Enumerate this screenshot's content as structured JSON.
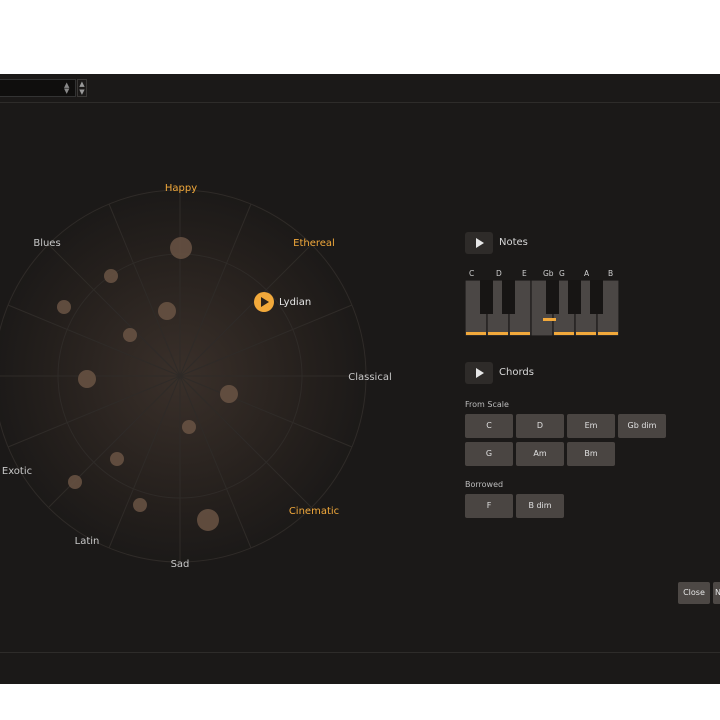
{
  "field": {
    "value": ""
  },
  "wheel": {
    "moods": [
      {
        "label": "Happy",
        "highlight": true
      },
      {
        "label": "Ethereal",
        "highlight": true
      },
      {
        "label": "Classical",
        "highlight": false
      },
      {
        "label": "Cinematic",
        "highlight": true
      },
      {
        "label": "Sad",
        "highlight": false
      },
      {
        "label": "Latin",
        "highlight": false
      },
      {
        "label": "Exotic",
        "highlight": false
      },
      {
        "label": "Blues",
        "highlight": false
      }
    ],
    "selected_scale": "Lydian",
    "accent_color": "#f2a93b",
    "muted_color": "#c8c8c8"
  },
  "notes": {
    "title": "Notes",
    "note_labels": [
      "C",
      "D",
      "E",
      "Gb",
      "G",
      "A",
      "B"
    ]
  },
  "chords": {
    "title": "Chords",
    "from_scale_label": "From Scale",
    "from_scale": [
      "C",
      "D",
      "Em",
      "Gb dim",
      "G",
      "Am",
      "Bm"
    ],
    "borrowed_label": "Borrowed",
    "borrowed": [
      "F",
      "B dim"
    ]
  },
  "footer": {
    "close_label": "Close",
    "next_label": "N"
  }
}
